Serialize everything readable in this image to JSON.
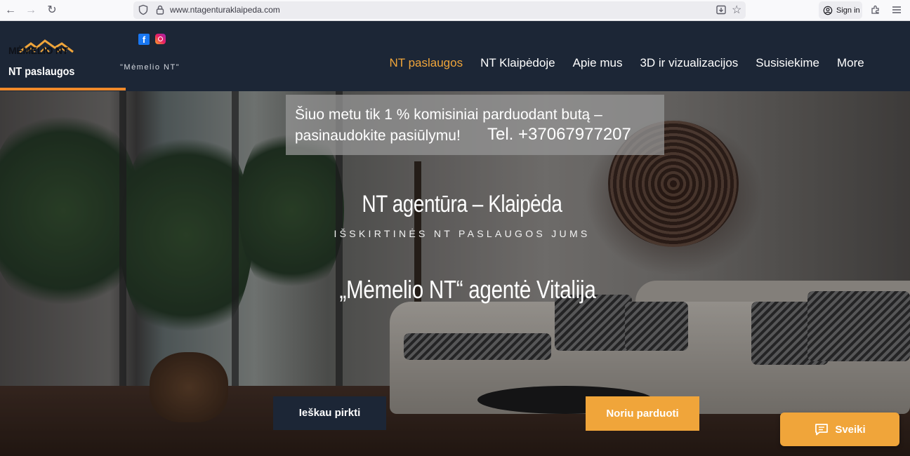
{
  "browser": {
    "url": "www.ntagenturaklaipeda.com",
    "sign_in": "Sign in"
  },
  "header": {
    "logo_text": "MĖMELIO NT",
    "site_name": "NT paslaugos",
    "tagline": "\"Mėmelio NT\"",
    "nav": [
      {
        "label": "NT paslaugos",
        "active": true
      },
      {
        "label": "NT Klaipėdoje"
      },
      {
        "label": "Apie mus"
      },
      {
        "label": "3D ir vizualizacijos"
      },
      {
        "label": "Susisiekime"
      },
      {
        "label": "More"
      }
    ],
    "accent_color": "#f0892a"
  },
  "hero": {
    "promo_text": "Šiuo metu tik 1 % komisiniai parduodant butą – pasinaudokite pasiūlymu!",
    "promo_phone": "Tel. +37067977207",
    "title": "NT agentūra – Klaipėda",
    "subtitle": "IŠSKIRTINĖS NT PASLAUGOS JUMS",
    "agent": "„Mėmelio NT“ agentė Vitalija",
    "buy_button": "Ieškau pirkti",
    "sell_button": "Noriu parduoti"
  },
  "chat": {
    "label": "Sveiki",
    "icon": "chat-icon"
  },
  "colors": {
    "header_bg": "#1c2636",
    "accent": "#f0a53a"
  }
}
